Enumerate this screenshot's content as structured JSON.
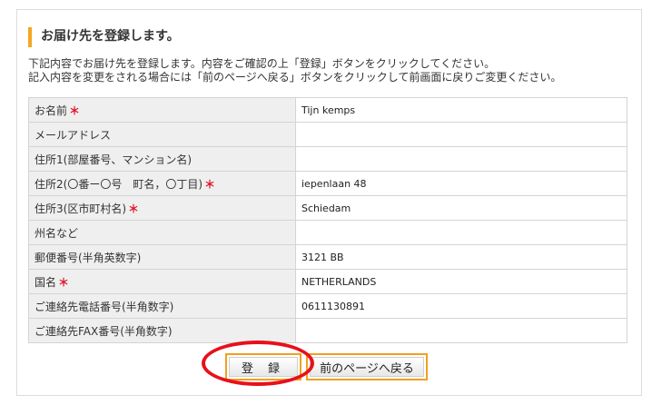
{
  "heading": "お届け先を登録します。",
  "description": {
    "line1": "下記内容でお届け先を登録します。内容をご確認の上「登録」ボタンをクリックしてください。",
    "line2": "記入内容を変更をされる場合には「前のページへ戻る」ボタンをクリックして前画面に戻りご変更ください。"
  },
  "required_mark": "＊",
  "rows": [
    {
      "label": "お名前",
      "required": true,
      "value": "Tijn kemps"
    },
    {
      "label": "メールアドレス",
      "required": false,
      "value": ""
    },
    {
      "label": "住所1(部屋番号、マンション名)",
      "required": false,
      "value": ""
    },
    {
      "label": "住所2(〇番ー〇号　町名，〇丁目)",
      "required": true,
      "value": "iepenlaan 48"
    },
    {
      "label": "住所3(区市町村名)",
      "required": true,
      "value": "Schiedam"
    },
    {
      "label": "州名など",
      "required": false,
      "value": ""
    },
    {
      "label": "郵便番号(半角英数字)",
      "required": false,
      "value": "3121 BB"
    },
    {
      "label": "国名",
      "required": true,
      "value": "NETHERLANDS"
    },
    {
      "label": "ご連絡先電話番号(半角数字)",
      "required": false,
      "value": "0611130891"
    },
    {
      "label": "ご連絡先FAX番号(半角数字)",
      "required": false,
      "value": ""
    }
  ],
  "buttons": {
    "register": "登 録",
    "back": "前のページへ戻る"
  },
  "colors": {
    "accent": "#f5a623",
    "required": "#e0152a",
    "annotation": "#e8101a"
  }
}
